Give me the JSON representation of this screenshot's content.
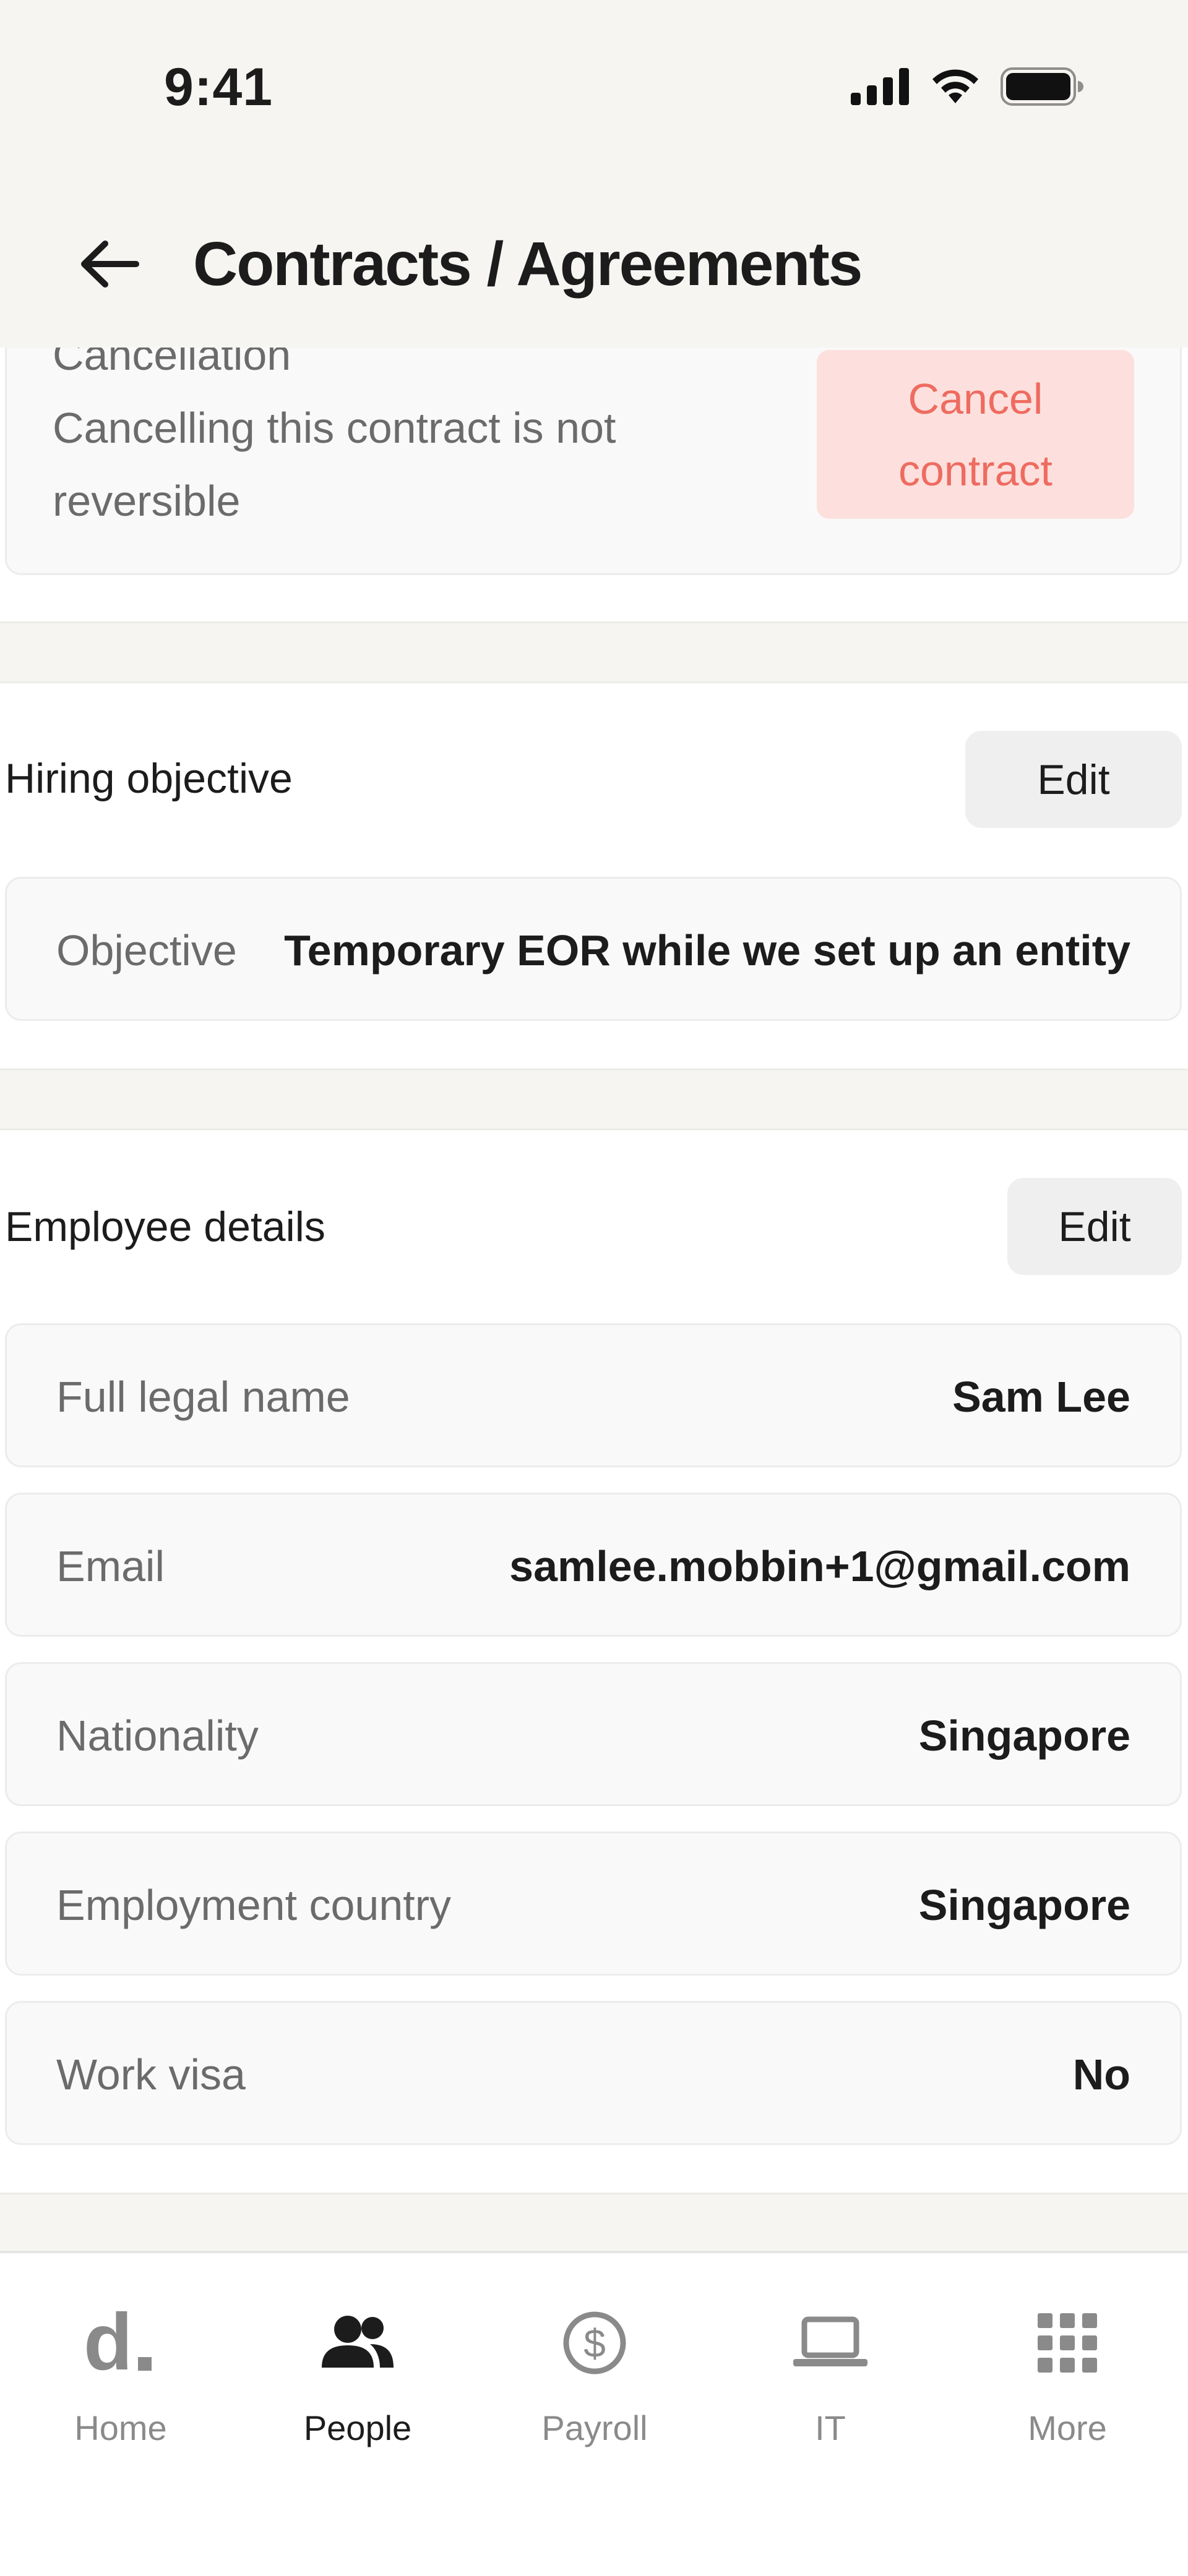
{
  "status_bar": {
    "time": "9:41"
  },
  "header": {
    "title": "Contracts / Agreements"
  },
  "cancellation": {
    "heading": "Cancellation",
    "description_line1": "Cancelling this contract is not",
    "description_line2": "reversible",
    "button_line1": "Cancel",
    "button_line2": "contract"
  },
  "hiring_objective": {
    "title": "Hiring objective",
    "edit_label": "Edit",
    "label": "Objective",
    "value": "Temporary EOR while we set up an entity"
  },
  "employee_details": {
    "title": "Employee details",
    "edit_label": "Edit",
    "rows": [
      {
        "label": "Full legal name",
        "value": "Sam Lee"
      },
      {
        "label": "Email",
        "value": "samlee.mobbin+1@gmail.com"
      },
      {
        "label": "Nationality",
        "value": "Singapore"
      },
      {
        "label": "Employment country",
        "value": "Singapore"
      },
      {
        "label": "Work visa",
        "value": "No"
      }
    ]
  },
  "tabbar": {
    "items": [
      {
        "label": "Home",
        "icon": "deel-logo-icon"
      },
      {
        "label": "People",
        "icon": "people-icon",
        "active": true
      },
      {
        "label": "Payroll",
        "icon": "dollar-circle-icon"
      },
      {
        "label": "IT",
        "icon": "laptop-icon"
      },
      {
        "label": "More",
        "icon": "grid-icon"
      }
    ]
  },
  "colors": {
    "accent_danger": "#ee6b60",
    "danger_bg": "#fde0dd",
    "header_bg": "#f6f5f2"
  }
}
